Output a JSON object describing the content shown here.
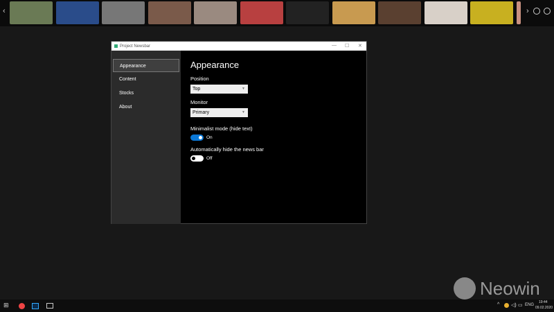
{
  "newsbar": {
    "thumb_colors": [
      "#6a7a55",
      "#2a4c8a",
      "#777777",
      "#7a5a4a",
      "#9a8a80",
      "#b84040",
      "#222222",
      "#c89a50",
      "#5a4030",
      "#d8d0c8",
      "#c8b020",
      "#c89080"
    ]
  },
  "window": {
    "title": "Project Newsbar",
    "minimize": "—",
    "maximize": "☐",
    "close": "✕"
  },
  "sidebar": {
    "items": [
      {
        "label": "Appearance"
      },
      {
        "label": "Content"
      },
      {
        "label": "Stocks"
      },
      {
        "label": "About"
      }
    ]
  },
  "main": {
    "heading": "Appearance",
    "position_label": "Position",
    "position_value": "Top",
    "monitor_label": "Monitor",
    "monitor_value": "Primary",
    "minimalist_label": "Minimalist mode  (hide text)",
    "minimalist_state": "On",
    "autohide_label": "Automatically hide the news bar",
    "autohide_state": "Off"
  },
  "taskbar": {
    "lang": "ENG",
    "time": "19:44",
    "date": "09.02.2020"
  },
  "watermark": "Neowin"
}
